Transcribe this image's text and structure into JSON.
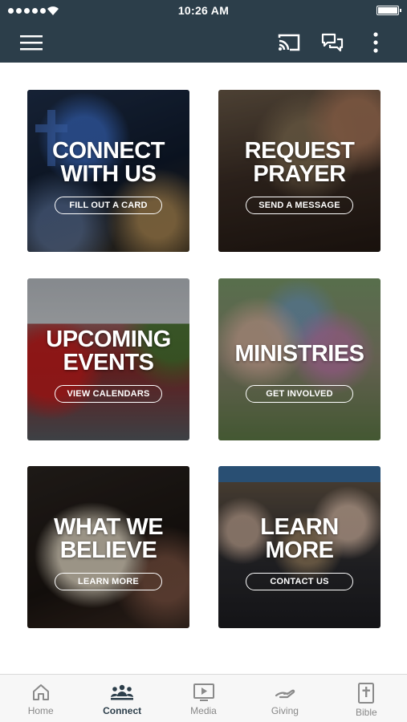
{
  "status": {
    "time": "10:26 AM"
  },
  "appbar": {
    "menu_icon": "hamburger-menu-icon",
    "cast_icon": "cast-icon",
    "chat_icon": "chat-bubbles-icon",
    "more_icon": "more-vertical-icon",
    "color": "#2c3e4a"
  },
  "tiles": [
    {
      "title_line1": "CONNECT",
      "title_line2": "WITH US",
      "button": "FILL OUT A CARD"
    },
    {
      "title_line1": "REQUEST",
      "title_line2": "PRAYER",
      "button": "SEND A MESSAGE"
    },
    {
      "title_line1": "UPCOMING",
      "title_line2": "EVENTS",
      "button": "VIEW CALENDARS"
    },
    {
      "title_line1": "MINISTRIES",
      "title_line2": "",
      "button": "GET INVOLVED"
    },
    {
      "title_line1": "WHAT WE",
      "title_line2": "BELIEVE",
      "button": "LEARN MORE"
    },
    {
      "title_line1": "LEARN",
      "title_line2": "MORE",
      "button": "CONTACT US"
    }
  ],
  "nav": [
    {
      "label": "Home",
      "icon": "home-icon"
    },
    {
      "label": "Connect",
      "icon": "people-group-icon",
      "active": true
    },
    {
      "label": "Media",
      "icon": "play-screen-icon"
    },
    {
      "label": "Giving",
      "icon": "giving-hand-icon"
    },
    {
      "label": "Bible",
      "icon": "bible-cross-icon"
    }
  ]
}
